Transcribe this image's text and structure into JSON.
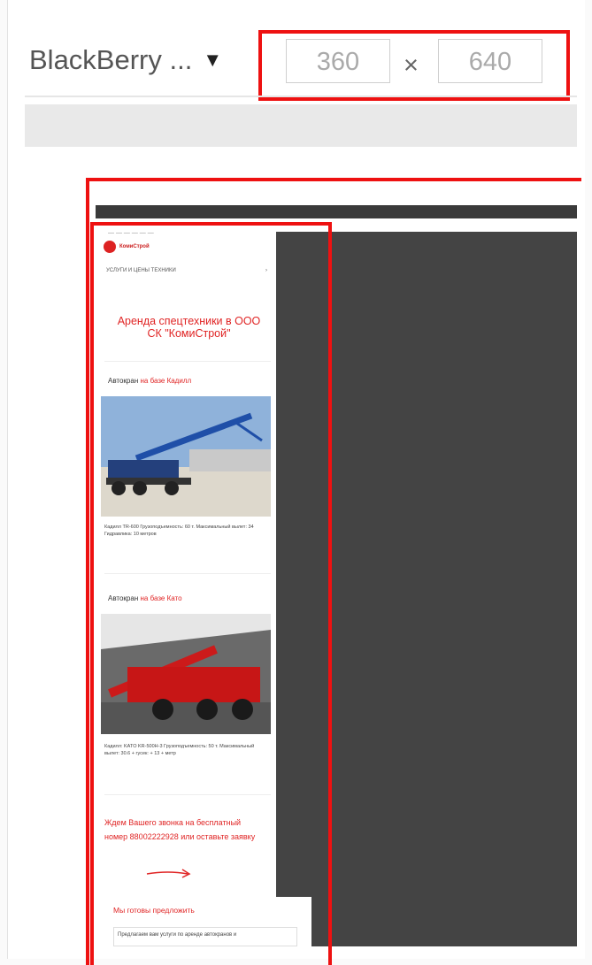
{
  "toolbar": {
    "device_label": "BlackBerry ...",
    "width_value": "360",
    "height_value": "640",
    "times_symbol": "×"
  },
  "site": {
    "url_text": "— — — — — —",
    "logo_text": "КомиСтрой",
    "menu_label": "УСЛУГИ И ЦЕНЫ ТЕХНИКИ",
    "menu_chevron": "›",
    "hero_title": "Аренда спецтехники в ООО СК \"КомиСтрой\"",
    "sections": [
      {
        "head_plain": "Автокран",
        "head_red": " на базе Кадилл",
        "desc": "Кадилл TR-600 Грузоподъемность: 60 т. Максимальный вылет: 34 Гидравлика: 10 метров"
      },
      {
        "head_plain": "Автокран",
        "head_red": " на базе Като",
        "desc": "Кадилл: KATO KR-500H-3 Грузоподъемность: 50 т. Максимальный вылет: 30.6 + гусек: + 13 + метр"
      }
    ],
    "cta_text": "Ждем Вашего звонка на бесплатный номер 88002222928 или оставьте заявку",
    "offer_head": "Мы готовы предложить",
    "offer_box": "Предлагаем вам услуги по аренде автокранов и"
  },
  "colors": {
    "accent_red": "#e02525",
    "highlight_red": "#ee1111",
    "dark_panel": "#444444"
  }
}
